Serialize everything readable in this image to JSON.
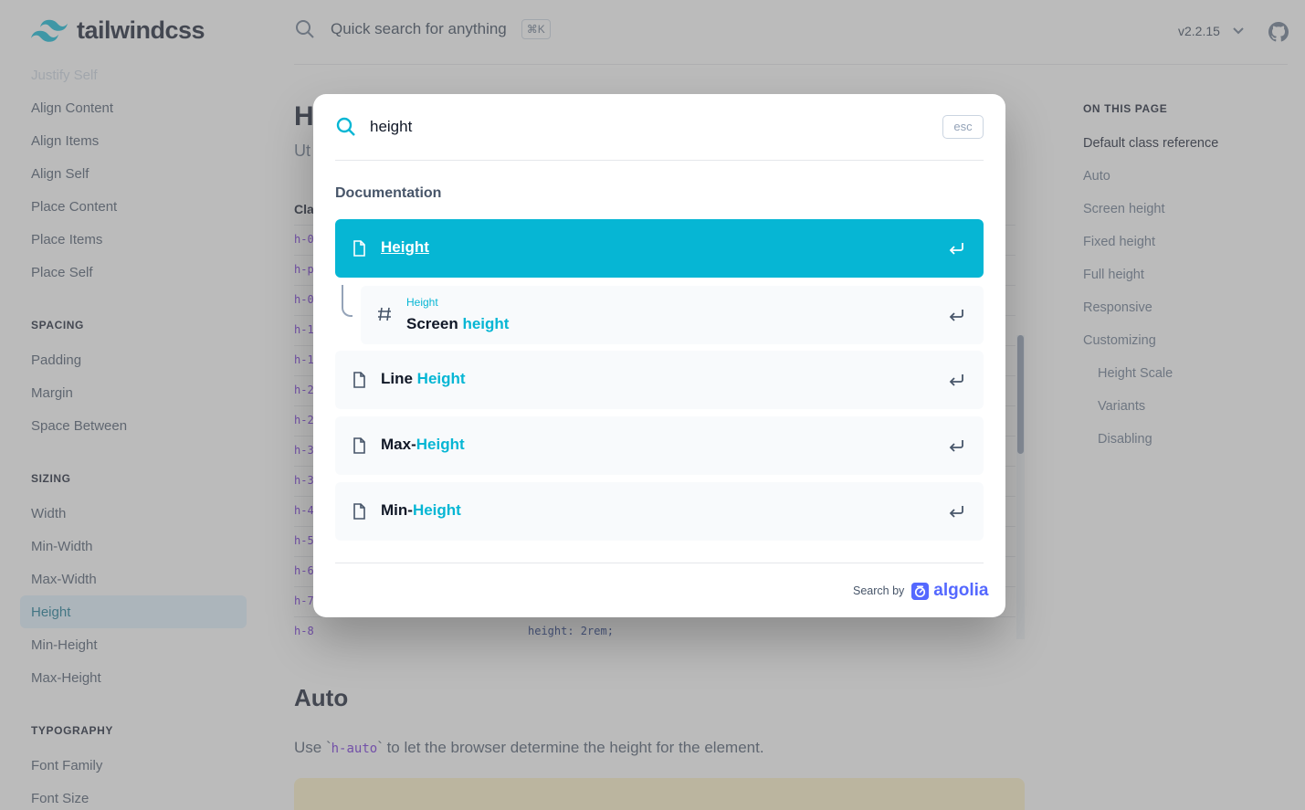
{
  "header": {
    "brand": "tailwindcss",
    "search_placeholder": "Quick search for anything",
    "search_shortcut": "⌘K",
    "version": "v2.2.15"
  },
  "sidebar": {
    "items_top": [
      "Justify Self",
      "Align Content",
      "Align Items",
      "Align Self",
      "Place Content",
      "Place Items",
      "Place Self"
    ],
    "section_spacing": "SPACING",
    "spacing_items": [
      "Padding",
      "Margin",
      "Space Between"
    ],
    "section_sizing": "SIZING",
    "sizing_items": [
      "Width",
      "Min-Width",
      "Max-Width",
      "Height",
      "Min-Height",
      "Max-Height"
    ],
    "section_typography": "TYPOGRAPHY",
    "typography_items": [
      "Font Family",
      "Font Size"
    ],
    "active": "Height"
  },
  "main": {
    "title_visible": "H",
    "subtitle_visible": "Ut",
    "table_header_visible": "Cla",
    "rows_visible": [
      "h-0",
      "h-p",
      "h-0",
      "h-1",
      "h-1",
      "h-2",
      "h-2",
      "h-3",
      "h-3",
      "h-4",
      "h-5",
      "h-6",
      "h-7"
    ],
    "last_row": {
      "class": "h-8",
      "property": "height: 2rem;"
    },
    "section_title": "Auto",
    "paragraph_before": "Use `",
    "paragraph_code": "h-auto",
    "paragraph_after": "` to let the browser determine the height for the element."
  },
  "toc": {
    "heading": "ON THIS PAGE",
    "items": [
      "Default class reference",
      "Auto",
      "Screen height",
      "Fixed height",
      "Full height",
      "Responsive",
      "Customizing"
    ],
    "sub_items": [
      "Height Scale",
      "Variants",
      "Disabling"
    ]
  },
  "modal": {
    "query": "height",
    "esc_label": "esc",
    "section": "Documentation",
    "hits": [
      {
        "title": "Height",
        "highlight": "",
        "prefix": ""
      },
      {
        "parent": "Height",
        "prefix": "Screen ",
        "highlight": "height"
      },
      {
        "prefix": "Line ",
        "highlight": "Height"
      },
      {
        "prefix": "Max-",
        "highlight": "Height"
      },
      {
        "prefix": "Min-",
        "highlight": "Height"
      }
    ],
    "footer_label": "Search by",
    "footer_brand": "algolia"
  },
  "colors": {
    "accent": "#06b6d4",
    "algolia": "#5468ff"
  }
}
